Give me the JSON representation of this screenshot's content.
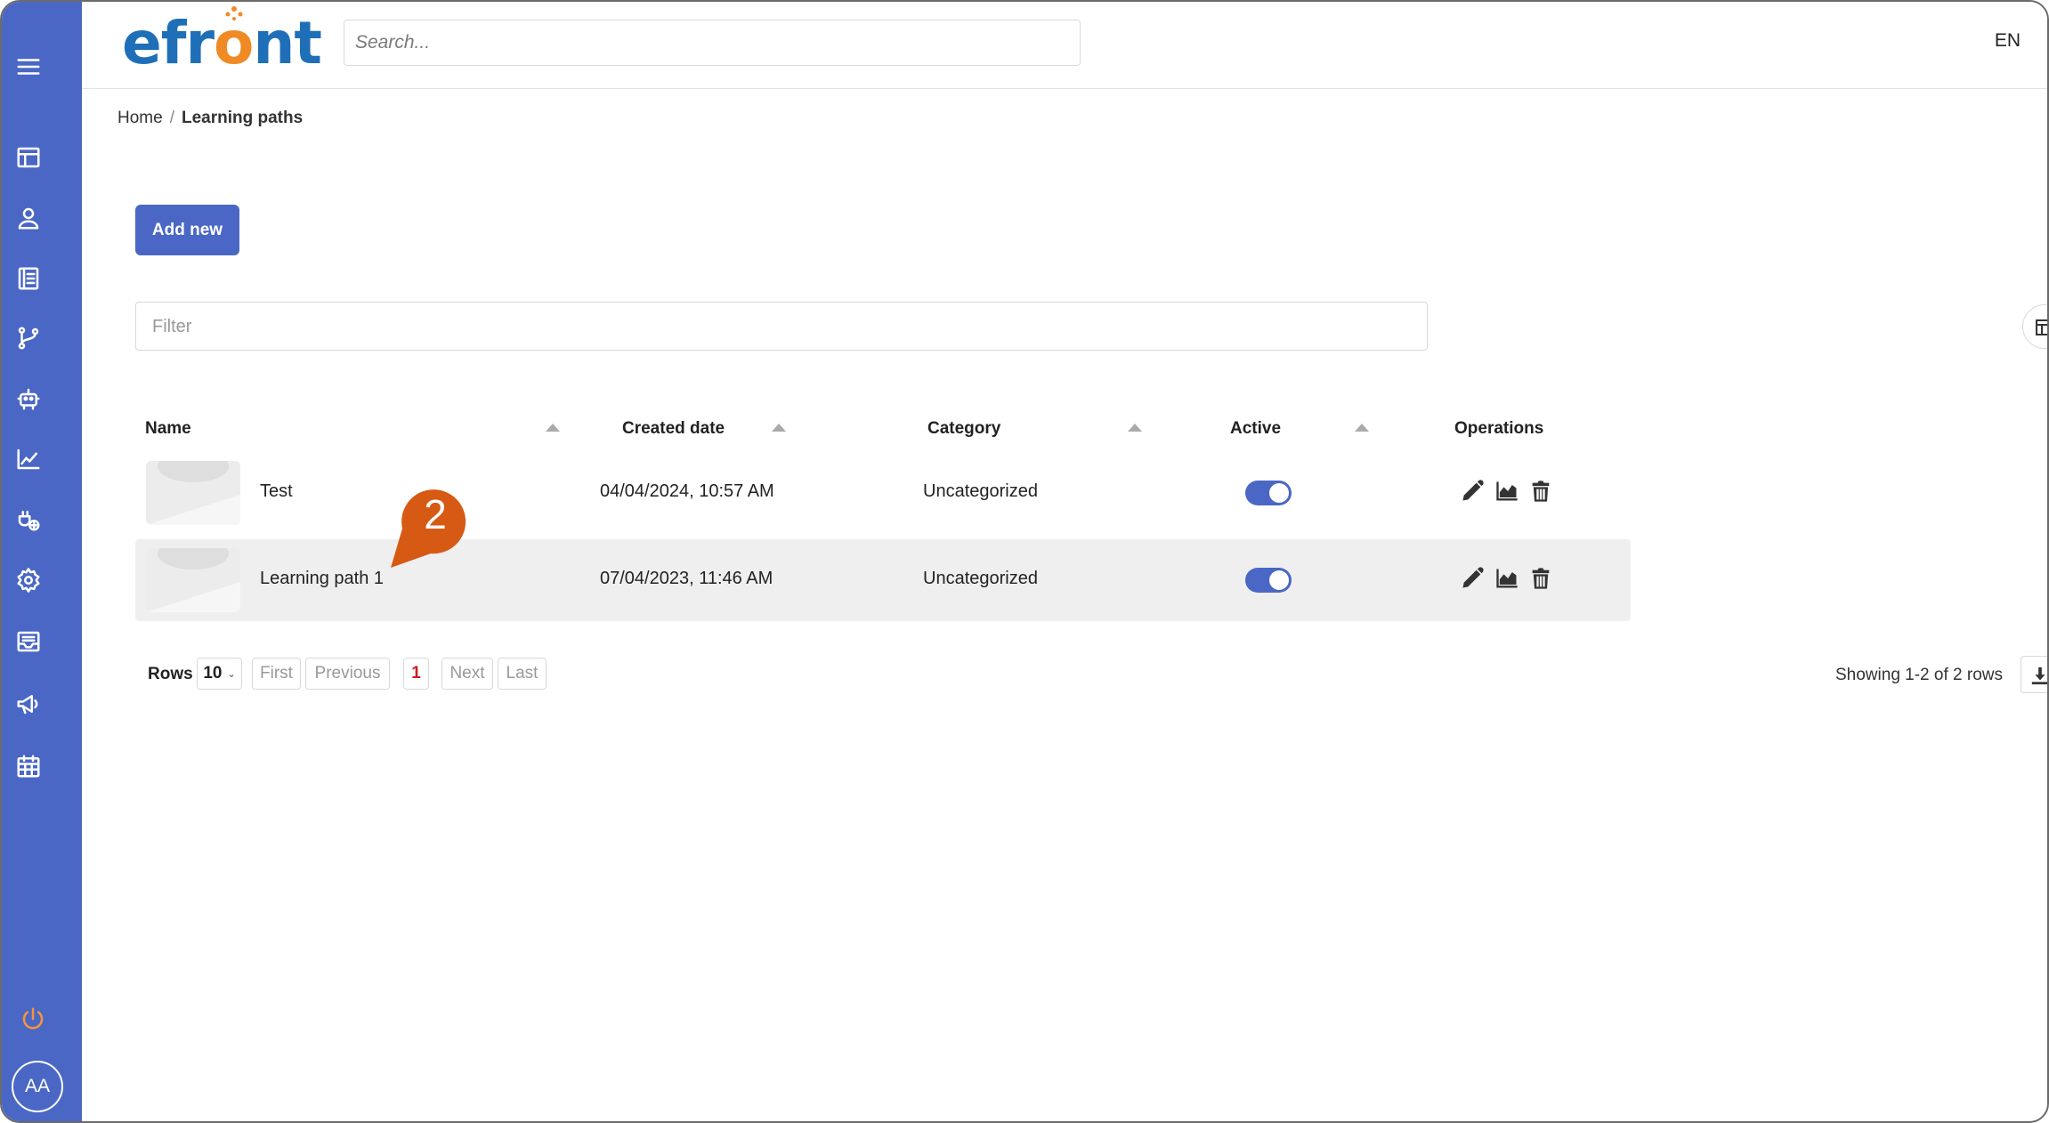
{
  "header": {
    "logo_text_a": "efr",
    "logo_text_o": "o",
    "logo_text_b": "nt",
    "search_placeholder": "Search...",
    "language": "EN"
  },
  "breadcrumb": {
    "home": "Home",
    "separator": "/",
    "current": "Learning paths"
  },
  "actions": {
    "add_new": "Add new"
  },
  "filter": {
    "placeholder": "Filter"
  },
  "table": {
    "columns": [
      "Name",
      "Created date",
      "Category",
      "Active",
      "Operations"
    ],
    "rows": [
      {
        "name": "Test",
        "created": "04/04/2024, 10:57 AM",
        "category": "Uncategorized",
        "active": true
      },
      {
        "name": "Learning path 1",
        "created": "07/04/2023, 11:46 AM",
        "category": "Uncategorized",
        "active": true
      }
    ]
  },
  "callout": {
    "number": "2",
    "color": "#d65a14"
  },
  "pagination": {
    "rows_label": "Rows",
    "rows_value": "10",
    "first": "First",
    "previous": "Previous",
    "current_page": "1",
    "next": "Next",
    "last": "Last",
    "showing": "Showing 1-2 of 2 rows"
  },
  "user": {
    "initials": "AA"
  },
  "colors": {
    "sidebar": "#4a67c5",
    "accent": "#4a67c5",
    "logo_blue": "#1f6fb8",
    "logo_orange": "#f08a24"
  }
}
